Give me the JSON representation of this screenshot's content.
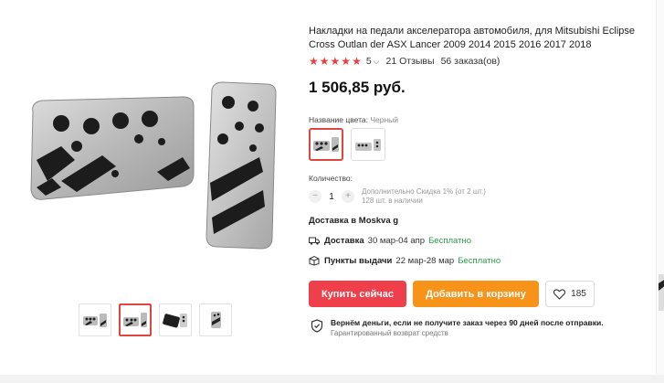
{
  "product": {
    "title": "Накладки на педали акселератора автомобиля, для Mitsubishi Eclipse Cross Outlan der ASX Lancer 2009 2014 2015 2016 2017 2018",
    "rating": "5",
    "rating_stars": 5,
    "reviews": "21 Отзывы",
    "orders": "56 заказа(ов)",
    "price": "1 506,85 руб."
  },
  "variants": {
    "color_label": "Название цвета:",
    "color_value": "Черный",
    "options": [
      {
        "name": "silver-black-set",
        "selected": true
      },
      {
        "name": "silver-black-set-alt",
        "selected": false
      }
    ]
  },
  "quantity": {
    "label": "Количество:",
    "minus": "−",
    "value": "1",
    "plus": "+",
    "discount": "Дополнительно Скидка 1% (от 2 шт.)",
    "stock": "128 шт. в наличии"
  },
  "shipping": {
    "ship_to": "Доставка в Moskva g",
    "delivery_label": "Доставка",
    "delivery_dates": "30 мар-04 апр",
    "delivery_price": "Бесплатно",
    "pickup_label": "Пункты выдачи",
    "pickup_dates": "22 мар-28 мар",
    "pickup_price": "Бесплатно"
  },
  "actions": {
    "buy_now": "Купить сейчас",
    "add_to_cart": "Добавить в корзину",
    "wishlist_count": "185"
  },
  "guarantee": {
    "line1": "Вернём деньги, если не получите заказ через 90 дней после отправки.",
    "line2": "Гарантированный возврат средств"
  },
  "colors": {
    "accent_red": "#ee3f4a",
    "accent_orange": "#f79318",
    "free_green": "#2e9a4b",
    "star": "#e8413b"
  },
  "gallery": {
    "thumbnails": [
      "pedal-set-front",
      "pedal-set-angle",
      "pedal-set-black",
      "brake-pedal-single"
    ],
    "active_thumb": 1
  }
}
